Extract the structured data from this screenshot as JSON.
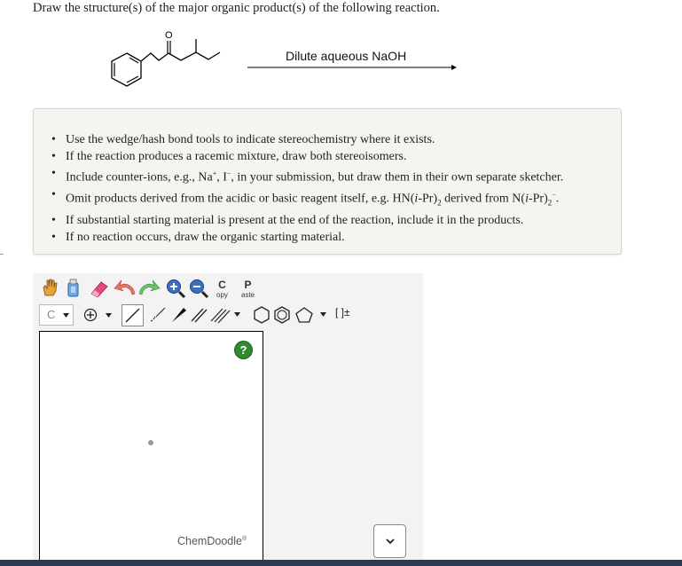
{
  "question": "Draw the structure(s) of the major organic product(s) of the following reaction.",
  "reaction": {
    "reagent": "Dilute aqueous NaOH",
    "carbonyl_atom": "O"
  },
  "instructions": [
    "Use the wedge/hash bond tools to indicate stereochemistry where it exists.",
    "If the reaction produces a racemic mixture, draw both stereoisomers.",
    [
      "Include counter-ions, e.g., Na",
      "+",
      ", I",
      "−",
      ", in your submission, but draw them in their own separate sketcher."
    ],
    [
      "Omit products derived from the acidic or basic reagent itself, e.g. HN(",
      "i",
      "-Pr)",
      "2",
      " derived from N(",
      "i",
      "-Pr)",
      "2",
      "−",
      "."
    ],
    "If substantial starting material is present at the end of the reaction, include it in the products.",
    "If no reaction occurs, draw the organic starting material."
  ],
  "toolbar": {
    "copy_letter": "C",
    "copy_rest": "opy",
    "paste_letter": "P",
    "paste_rest": "aste",
    "element_label": "C",
    "charges_label": "[ ]±"
  },
  "sketcher": {
    "help_label": "?",
    "brand": "ChemDoodle",
    "brand_mark": "®"
  },
  "icons": [
    "hand-icon",
    "erase-icon",
    "undo-icon",
    "redo-icon",
    "zoom-in-icon",
    "zoom-out-icon",
    "charge-icon",
    "single-bond-icon",
    "hash-bond-icon",
    "wedge-bond-icon",
    "double-bond-icon",
    "triple-bond-icon",
    "cyclohexane-icon",
    "benzene-icon",
    "cyclopentane-icon",
    "help-icon",
    "chevron-down-icon"
  ]
}
